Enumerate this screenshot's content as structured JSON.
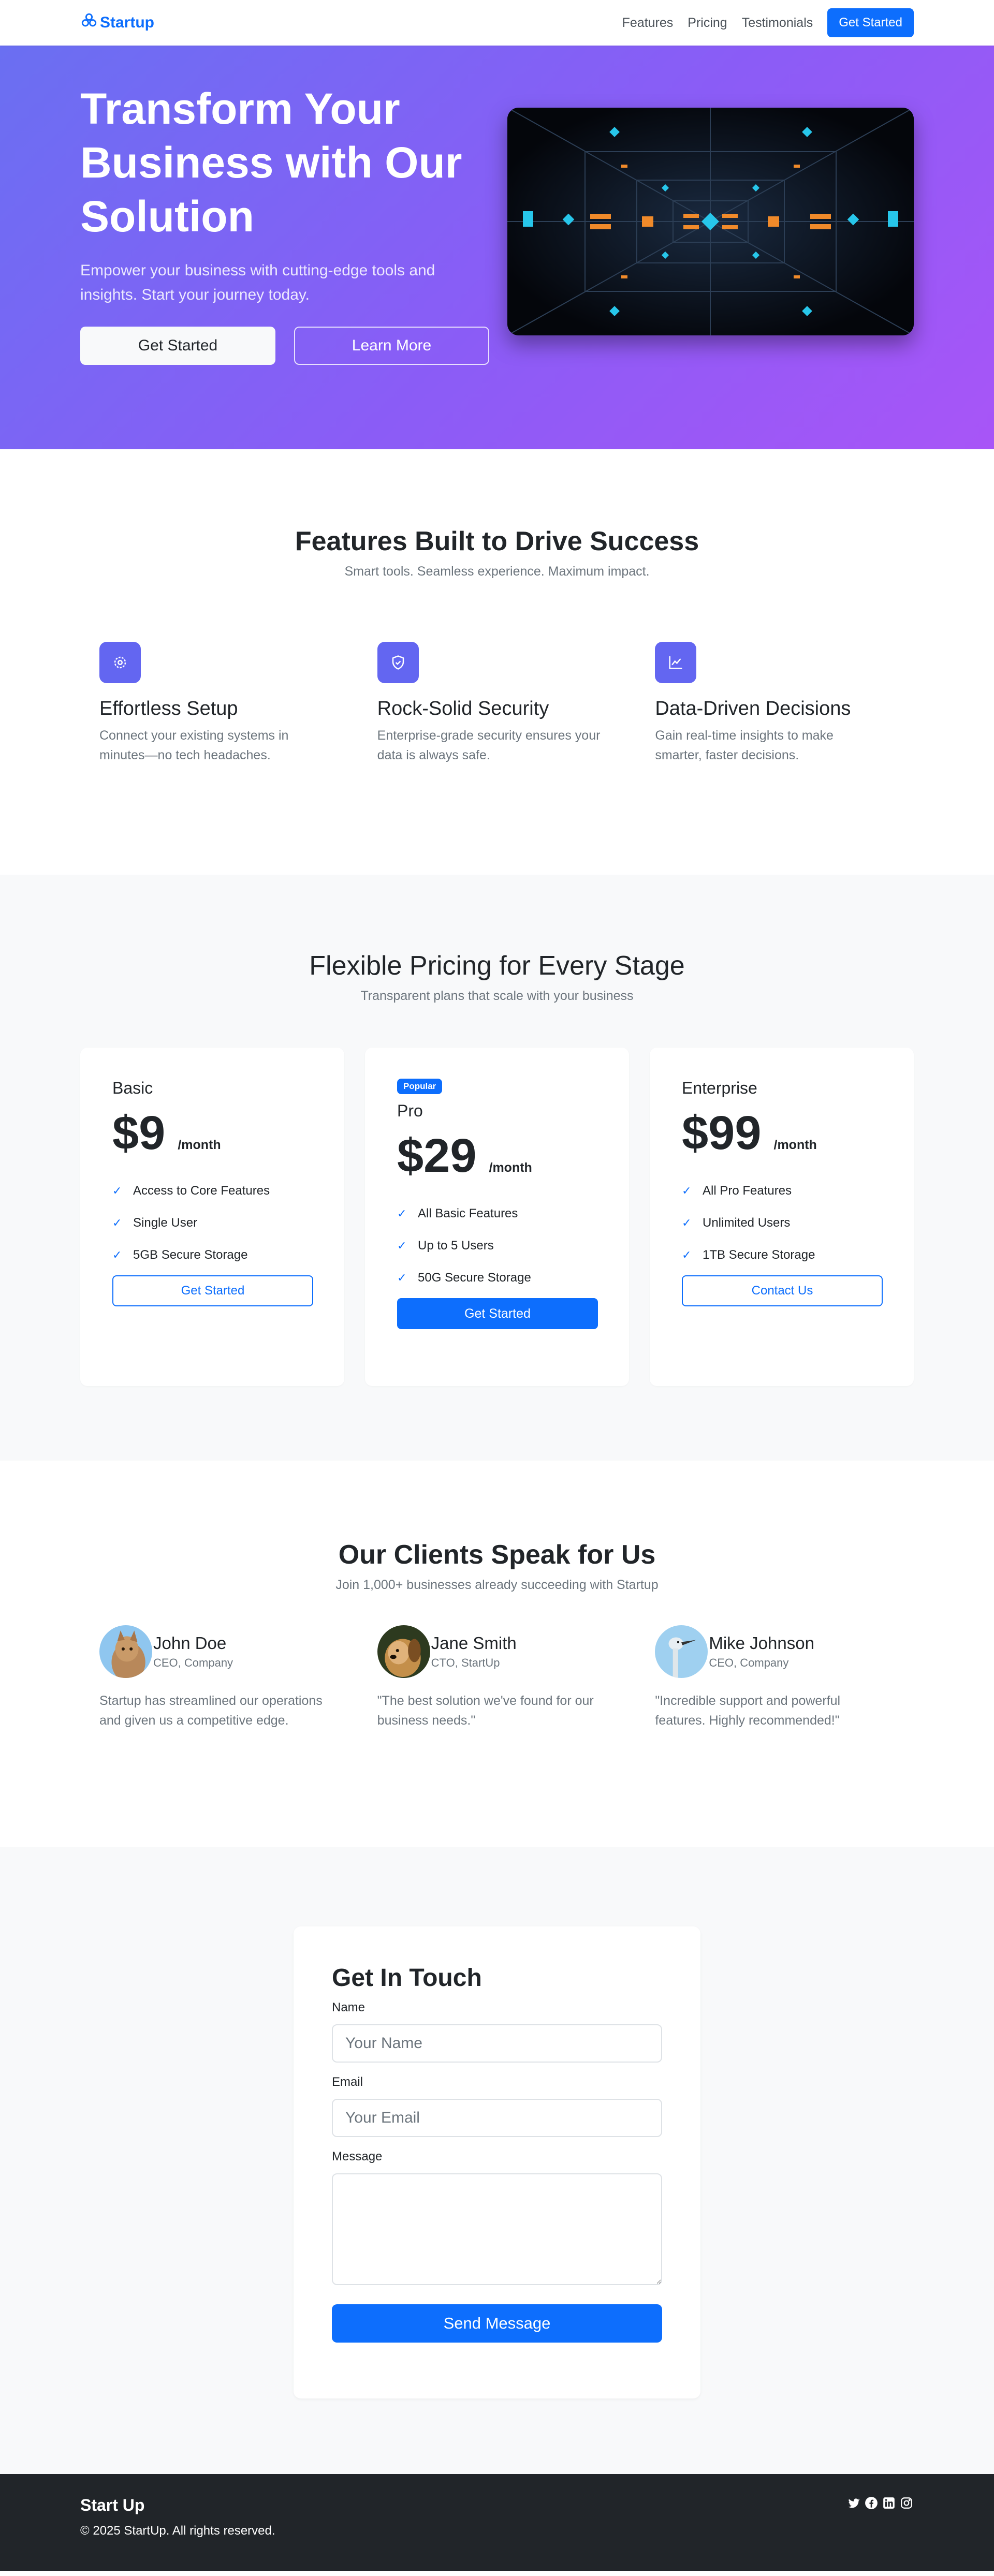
{
  "nav": {
    "brand": "Startup",
    "links": [
      "Features",
      "Pricing",
      "Testimonials"
    ],
    "cta": "Get Started"
  },
  "hero": {
    "title": "Transform Your Business with Our Solution",
    "subtitle": "Empower your business with cutting-edge tools and insights. Start your journey today.",
    "primary_button": "Get Started",
    "secondary_button": "Learn More"
  },
  "features": {
    "title": "Features Built to Drive Success",
    "subtitle": "Smart tools. Seamless experience. Maximum impact.",
    "items": [
      {
        "icon": "gear-icon",
        "title": "Effortless Setup",
        "text": "Connect your existing systems in minutes—no tech headaches."
      },
      {
        "icon": "shield-icon",
        "title": "Rock-Solid Security",
        "text": "Enterprise-grade security ensures your data is always safe."
      },
      {
        "icon": "chart-icon",
        "title": "Data-Driven Decisions",
        "text": "Gain real-time insights to make smarter, faster decisions."
      }
    ]
  },
  "pricing": {
    "title": "Flexible Pricing for Every Stage",
    "subtitle": "Transparent plans that scale with your business",
    "plans": [
      {
        "name": "Basic",
        "badge": "",
        "price": "$9",
        "period": "/month",
        "features": [
          "Access to Core Features",
          "Single User",
          "5GB Secure Storage"
        ],
        "button": "Get Started"
      },
      {
        "name": "Pro",
        "badge": "Popular",
        "price": "$29",
        "period": "/month",
        "features": [
          "All Basic Features",
          "Up to 5 Users",
          "50G Secure Storage"
        ],
        "button": "Get Started"
      },
      {
        "name": "Enterprise",
        "badge": "",
        "price": "$99",
        "period": "/month",
        "features": [
          "All Pro Features",
          "Unlimited Users",
          "1TB Secure Storage"
        ],
        "button": "Contact Us"
      }
    ]
  },
  "testimonials": {
    "title": "Our Clients Speak for Us",
    "subtitle": "Join 1,000+ businesses already succeeding with Startup",
    "items": [
      {
        "name": "John Doe",
        "role": "CEO, Company",
        "text": "Startup has streamlined our operations and given us a competitive edge."
      },
      {
        "name": "Jane Smith",
        "role": "CTO, StartUp",
        "text": "\"The best solution we've found for our business needs.\""
      },
      {
        "name": "Mike Johnson",
        "role": "CEO, Company",
        "text": "\"Incredible support and powerful features. Highly recommended!\""
      }
    ]
  },
  "contact": {
    "title": "Get In Touch",
    "name_label": "Name",
    "name_placeholder": "Your Name",
    "email_label": "Email",
    "email_placeholder": "Your Email",
    "message_label": "Message",
    "message_value": "",
    "submit": "Send Message"
  },
  "footer": {
    "brand": "Start Up",
    "copyright": "© 2025 StartUp. All rights reserved.",
    "socials": [
      "twitter-icon",
      "facebook-icon",
      "linkedin-icon",
      "instagram-icon"
    ]
  },
  "colors": {
    "primary": "#0d6efd",
    "feature_icon_bg": "#6366f1",
    "hero_gradient_start": "#6a6ff2",
    "hero_gradient_end": "#a855f7",
    "footer_bg": "#212529",
    "section_alt_bg": "#f8f9fa"
  }
}
